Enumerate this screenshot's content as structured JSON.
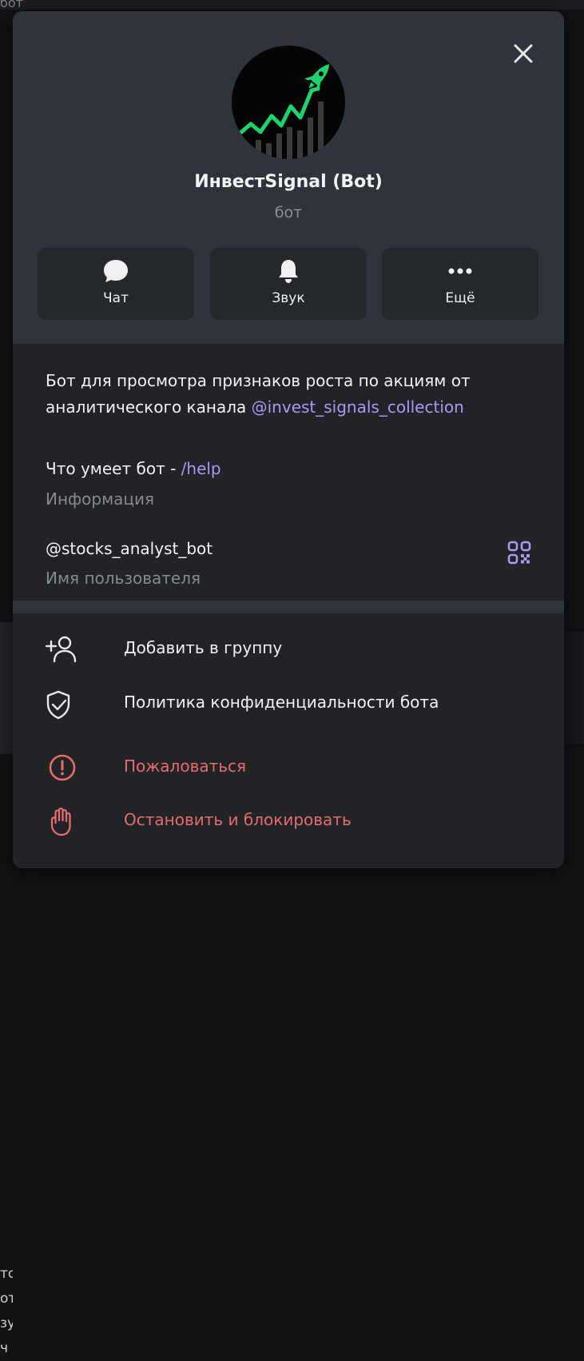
{
  "background": {
    "top_text": "бот",
    "side_letters": [
      "то",
      "от",
      "зу",
      "ч"
    ]
  },
  "profile": {
    "name": "ИнвестSignal (Bot)",
    "type": "бот",
    "avatar_icon": "rocket-chart-logo-icon"
  },
  "actions": [
    {
      "label": "Чат",
      "icon": "chat-bubble-icon"
    },
    {
      "label": "Звук",
      "icon": "bell-icon"
    },
    {
      "label": "Ещё",
      "icon": "more-dots-icon"
    }
  ],
  "info": {
    "description_text": "Бот для просмотра признаков роста по акциям от аналитического канала ",
    "description_link": "@invest_signals_collection",
    "help_prefix": "Что умеет бот - ",
    "help_command": "/help",
    "help_caption": "Информация",
    "username": "@stocks_analyst_bot",
    "username_caption": "Имя пользователя"
  },
  "menu": {
    "add_to_group": "Добавить в группу",
    "privacy_policy": "Политика конфиденциальности бота",
    "report": "Пожаловаться",
    "stop_and_block": "Остановить и блокировать"
  },
  "colors": {
    "link": "#a69af2",
    "danger": "#e36c6c",
    "accent_green": "#1fd36c"
  }
}
